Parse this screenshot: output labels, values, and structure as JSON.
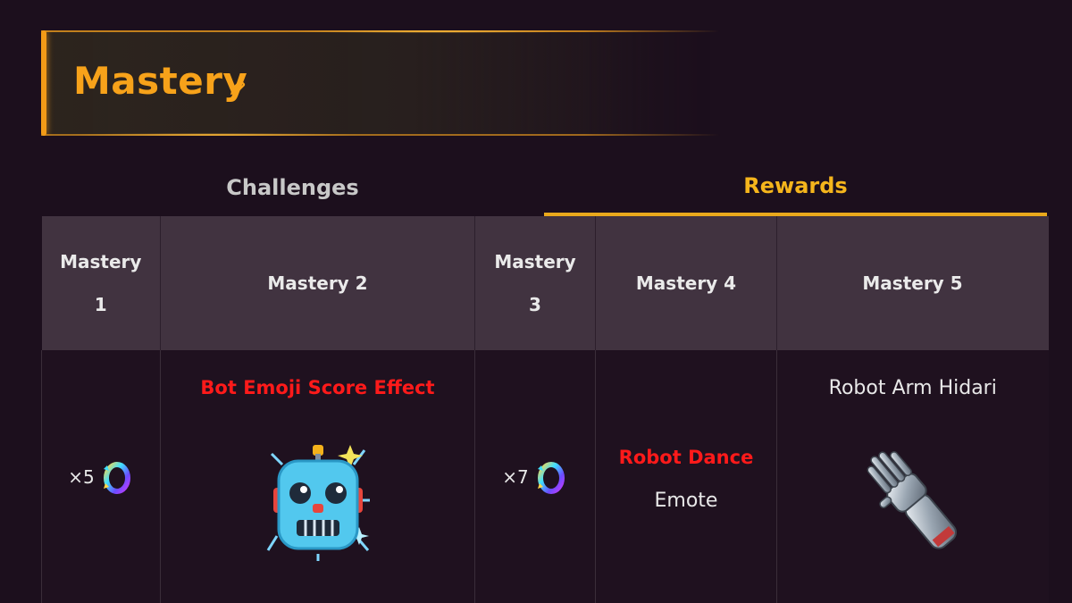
{
  "header": {
    "title": "Mastery",
    "accent_color": "#f7a21a",
    "icon": "pencil-icon"
  },
  "tabs": [
    {
      "label": "Challenges",
      "active": false
    },
    {
      "label": "Rewards",
      "active": true
    }
  ],
  "table": {
    "headers": [
      {
        "line1": "Mastery",
        "line2": "1"
      },
      {
        "line1": "Mastery 2",
        "line2": ""
      },
      {
        "line1": "Mastery",
        "line2": "3"
      },
      {
        "line1": "Mastery 4",
        "line2": ""
      },
      {
        "line1": "Mastery 5",
        "line2": ""
      }
    ],
    "rewards": {
      "m1": {
        "quantity": "×5",
        "icon": "mastery-ring-icon"
      },
      "m2": {
        "label": "Bot Emoji Score Effect",
        "icon": "robot-emoji-icon"
      },
      "m3": {
        "quantity": "×7",
        "icon": "mastery-ring-icon"
      },
      "m4": {
        "label": "Robot Dance",
        "sublabel": "Emote"
      },
      "m5": {
        "label": "Robot Arm Hidari",
        "icon": "robot-arm-icon"
      }
    },
    "colors": {
      "highlight_red": "#ff1a1a",
      "tab_active": "#f5b51c"
    }
  }
}
